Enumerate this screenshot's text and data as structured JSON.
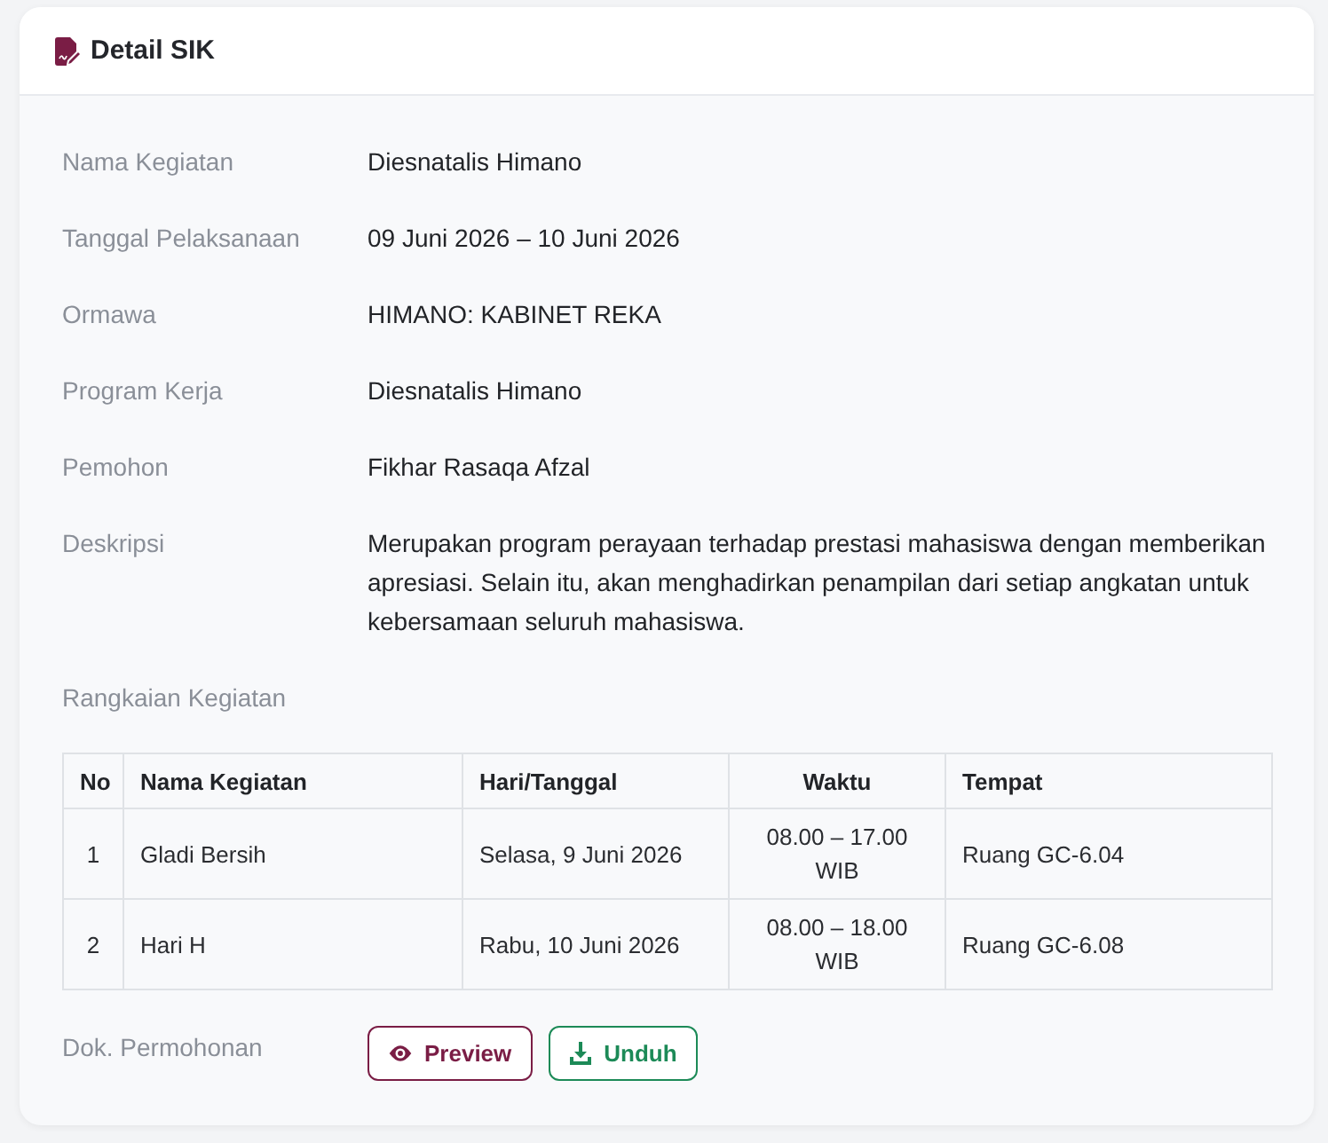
{
  "card": {
    "title": "Detail SIK"
  },
  "details": [
    {
      "label": "Nama Kegiatan",
      "value": "Diesnatalis Himano"
    },
    {
      "label": "Tanggal Pelaksanaan",
      "value": "09 Juni 2026 – 10 Juni 2026"
    },
    {
      "label": "Ormawa",
      "value": "HIMANO: KABINET REKA"
    },
    {
      "label": "Program Kerja",
      "value": "Diesnatalis Himano"
    },
    {
      "label": "Pemohon",
      "value": "Fikhar Rasaqa Afzal"
    },
    {
      "label": "Deskripsi",
      "value": "Merupakan program perayaan terhadap prestasi mahasiswa dengan memberikan apresiasi. Selain itu, akan menghadirkan penampilan dari setiap angkatan untuk kebersamaan seluruh mahasiswa."
    }
  ],
  "schedule": {
    "label": "Rangkaian Kegiatan",
    "columns": [
      "No",
      "Nama Kegiatan",
      "Hari/Tanggal",
      "Waktu",
      "Tempat"
    ],
    "rows": [
      [
        "1",
        "Gladi Bersih",
        "Selasa, 9 Juni 2026",
        "08.00 – 17.00 WIB",
        "Ruang GC-6.04"
      ],
      [
        "2",
        "Hari H",
        "Rabu, 10 Juni 2026",
        "08.00 – 18.00 WIB",
        "Ruang GC-6.08"
      ]
    ]
  },
  "document": {
    "label": "Dok. Permohonan",
    "buttons": [
      {
        "label": "Preview",
        "kind": "preview"
      },
      {
        "label": "Unduh",
        "kind": "download"
      }
    ]
  }
}
